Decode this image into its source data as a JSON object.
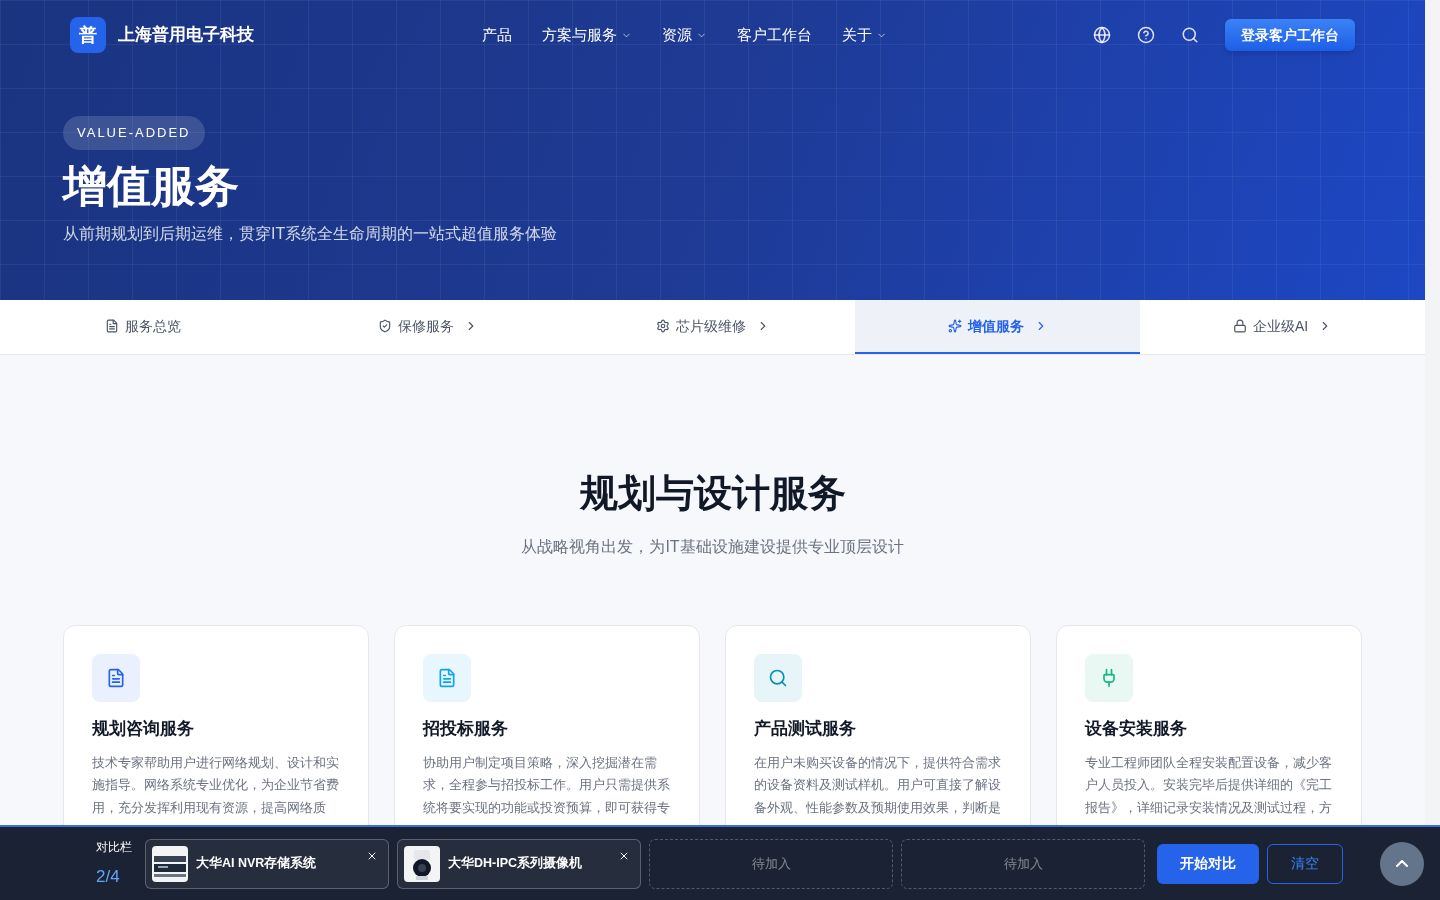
{
  "header": {
    "logo_mark": "普",
    "brand": "上海普用电子科技",
    "nav": [
      {
        "label": "产品",
        "dropdown": false
      },
      {
        "label": "方案与服务",
        "dropdown": true
      },
      {
        "label": "资源",
        "dropdown": true
      },
      {
        "label": "客户工作台",
        "dropdown": false
      },
      {
        "label": "关于",
        "dropdown": true
      }
    ],
    "login_button": "登录客户工作台"
  },
  "hero": {
    "badge": "VALUE-ADDED",
    "title": "增值服务",
    "subtitle": "从前期规划到后期运维，贯穿IT系统全生命周期的一站式超值服务体验"
  },
  "tabs": [
    {
      "label": "服务总览",
      "chevron": false,
      "selected": false
    },
    {
      "label": "保修服务",
      "chevron": true,
      "selected": false
    },
    {
      "label": "芯片级维修",
      "chevron": true,
      "selected": false
    },
    {
      "label": "增值服务",
      "chevron": true,
      "selected": true
    },
    {
      "label": "企业级AI",
      "chevron": true,
      "selected": false
    }
  ],
  "section": {
    "title": "规划与设计服务",
    "subtitle": "从战略视角出发，为IT基础设施建设提供专业顶层设计"
  },
  "cards": [
    {
      "color": "#2563eb",
      "title": "规划咨询服务",
      "lines": [
        "技术专家帮助用户进行网络规划、设计和实",
        "施指导。网络系统专业优化，为企业节省费",
        "用，充分发挥利用现有资源，提高网络质"
      ]
    },
    {
      "color": "#0ea5e9",
      "title": "招投标服务",
      "lines": [
        "协助用户制定项目策略，深入挖掘潜在需",
        "求，全程参与招投标工作。用户只需提供系",
        "统将要实现的功能或投资预算，即可获得专"
      ]
    },
    {
      "color": "#0891b2",
      "title": "产品测试服务",
      "lines": [
        "在用户未购买设备的情况下，提供符合需求",
        "的设备资料及测试样机。用户可直接了解设",
        "备外观、性能参数及预期使用效果，判断是"
      ]
    },
    {
      "color": "#10b981",
      "title": "设备安装服务",
      "lines": [
        "专业工程师团队全程安装配置设备，减少客",
        "户人员投入。安装完毕后提供详细的《完工",
        "报告》，详细记录安装情况及测试过程，方"
      ]
    }
  ],
  "compare_bar": {
    "label": "对比栏",
    "count": "2/4",
    "slots": [
      {
        "kind": "product",
        "name": "大华AI NVR存储系统"
      },
      {
        "kind": "product",
        "name": "大华DH-IPC系列摄像机"
      },
      {
        "kind": "empty",
        "name": "待加入"
      },
      {
        "kind": "empty",
        "name": "待加入"
      }
    ],
    "compare_button": "开始对比",
    "clear_button": "清空"
  }
}
